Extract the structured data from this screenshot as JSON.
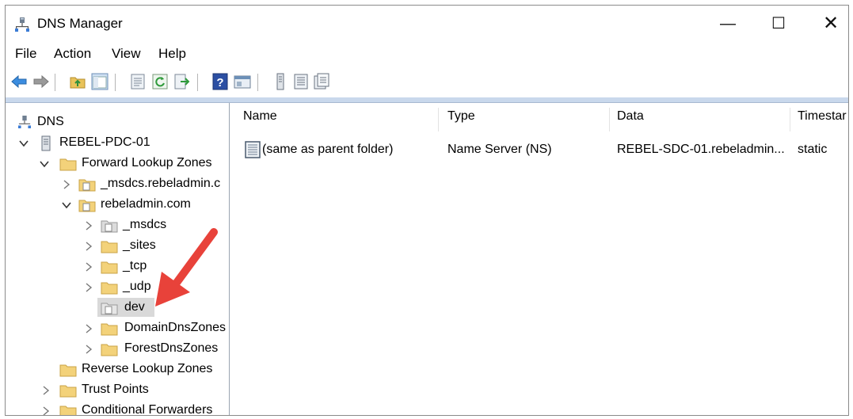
{
  "window": {
    "title": "DNS Manager"
  },
  "controls": {
    "minimize": "—",
    "maximize": "☐",
    "close": "✕"
  },
  "menu": [
    "File",
    "Action",
    "View",
    "Help"
  ],
  "toolbar": [
    "back-icon",
    "forward-icon",
    "up-folder-icon",
    "show-hide-tree-icon",
    "export-list-icon",
    "refresh-icon",
    "export-icon",
    "help-icon",
    "console-icon",
    "server-icon",
    "zone-icon",
    "record-icon"
  ],
  "tree": {
    "root": "DNS",
    "server": "REBEL-PDC-01",
    "forward": "Forward Lookup Zones",
    "msdcs_zone": "_msdcs.rebeladmin.c",
    "zone": "rebeladmin.com",
    "children": [
      "_msdcs",
      "_sites",
      "_tcp",
      "_udp",
      "dev",
      "DomainDnsZones",
      "ForestDnsZones"
    ],
    "reverse": "Reverse Lookup Zones",
    "trust": "Trust Points",
    "conditional": "Conditional Forwarders"
  },
  "list": {
    "columns": [
      "Name",
      "Type",
      "Data",
      "Timestar"
    ],
    "rows": [
      {
        "name": "(same as parent folder)",
        "type": "Name Server (NS)",
        "data": "REBEL-SDC-01.rebeladmin...",
        "timestamp": "static"
      }
    ]
  },
  "colors": {
    "arrow": "#e8423a",
    "folder": "#f3d27a",
    "selection": "#d9d9d9"
  }
}
